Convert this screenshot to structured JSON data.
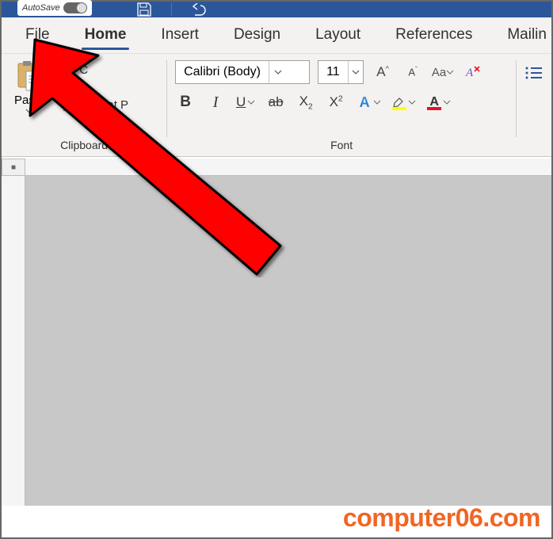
{
  "titlebar": {
    "autosave_label": "AutoSave"
  },
  "tabs": {
    "file": "File",
    "home": "Home",
    "insert": "Insert",
    "design": "Design",
    "layout": "Layout",
    "references": "References",
    "mailings": "Mailin"
  },
  "clipboard": {
    "paste": "Paste",
    "cut": "C",
    "format_painter": "Format P",
    "group_label": "Clipboard"
  },
  "font": {
    "family": "Calibri (Body)",
    "size": "11",
    "bold": "B",
    "italic": "I",
    "underline": "U",
    "strike": "ab",
    "sub": "X",
    "sup": "X",
    "text_effects_letter": "A",
    "highlight_letter": "A",
    "font_color_letter": "A",
    "aa": "Aa",
    "group_label": "Font"
  },
  "watermark": "computer06.com"
}
